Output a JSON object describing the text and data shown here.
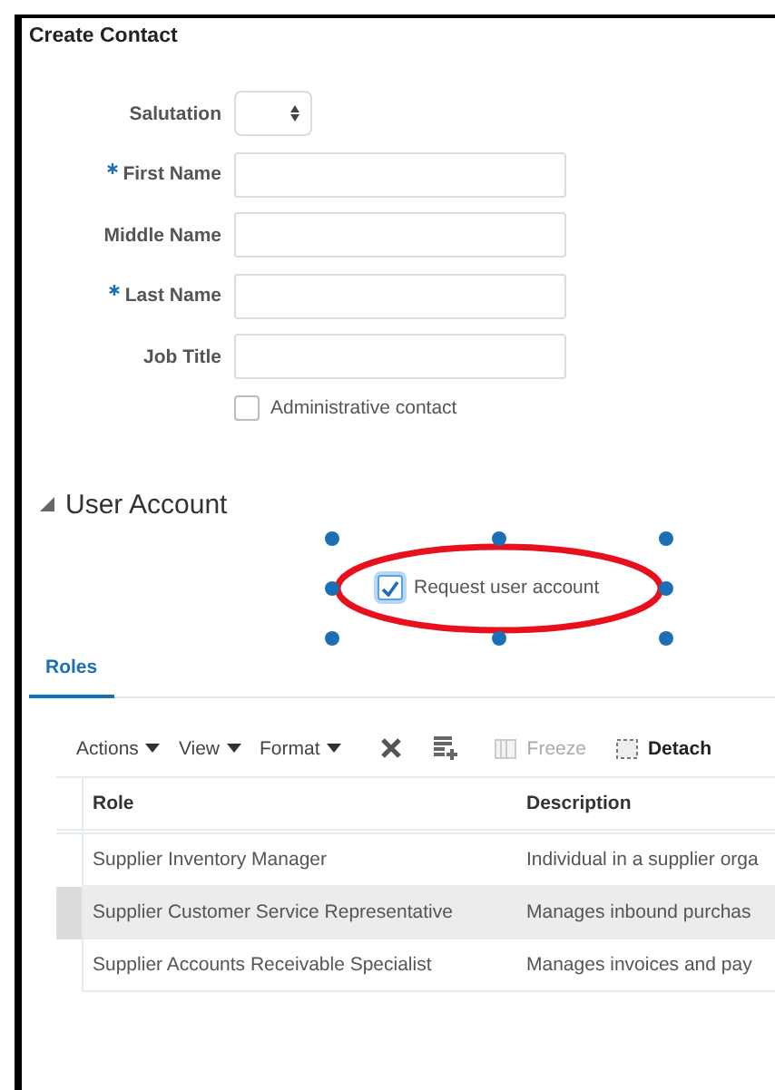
{
  "window": {
    "title": "Create Contact"
  },
  "form": {
    "fields": [
      {
        "label": "Salutation",
        "required": false,
        "kind": "select"
      },
      {
        "label": "First Name",
        "required": true,
        "kind": "text"
      },
      {
        "label": "Middle Name",
        "required": false,
        "kind": "text"
      },
      {
        "label": "Last Name",
        "required": true,
        "kind": "text"
      },
      {
        "label": "Job Title",
        "required": false,
        "kind": "text"
      }
    ],
    "checkbox": {
      "label": "Administrative contact",
      "checked": false
    }
  },
  "section": {
    "title": "User Account",
    "expanded": true,
    "checkbox": {
      "label": "Request user account",
      "checked": true
    },
    "annotation": {
      "kind": "ellipse",
      "color": "#e8101c",
      "selected": true
    }
  },
  "tabs": [
    {
      "label": "Roles",
      "selected": true
    }
  ],
  "toolbar": [
    {
      "kind": "menu",
      "label": "Actions"
    },
    {
      "kind": "menu",
      "label": "View"
    },
    {
      "kind": "menu",
      "label": "Format"
    },
    {
      "kind": "delete"
    },
    {
      "kind": "add"
    },
    {
      "kind": "freeze",
      "label": "Freeze",
      "disabled": true
    },
    {
      "kind": "detach",
      "label": "Detach",
      "disabled": false
    }
  ],
  "table": {
    "columns": [
      "Role",
      "Description"
    ],
    "rows": [
      {
        "cells": [
          "Supplier Inventory Manager",
          "Individual in a supplier orga"
        ],
        "selected": false
      },
      {
        "cells": [
          "Supplier Customer Service Representative",
          "Manages inbound purchas"
        ],
        "selected": true
      },
      {
        "cells": [
          "Supplier Accounts Receivable Specialist",
          "Manages invoices and pay"
        ],
        "selected": false
      }
    ]
  }
}
